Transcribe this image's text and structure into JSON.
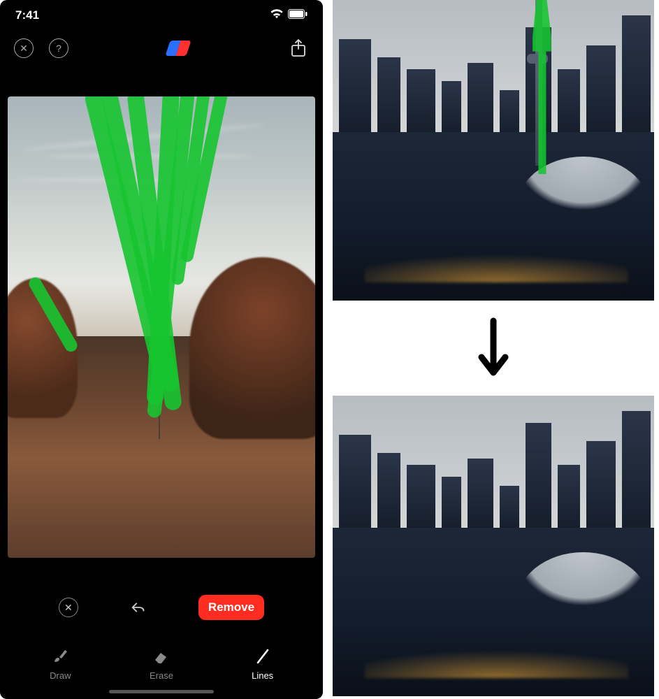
{
  "statusbar": {
    "time": "7:41"
  },
  "topnav": {
    "close_label": "✕",
    "help_label": "?",
    "tool_active": "eraser"
  },
  "actions": {
    "cancel_label": "✕",
    "undo_label": "undo",
    "remove_label": "Remove"
  },
  "tools": [
    {
      "id": "draw",
      "label": "Draw",
      "active": false
    },
    {
      "id": "erase",
      "label": "Erase",
      "active": false
    },
    {
      "id": "lines",
      "label": "Lines",
      "active": true
    }
  ],
  "mark_color": "#16c430",
  "right_panel": {
    "relation": "before-after",
    "masked_object": "tower"
  }
}
